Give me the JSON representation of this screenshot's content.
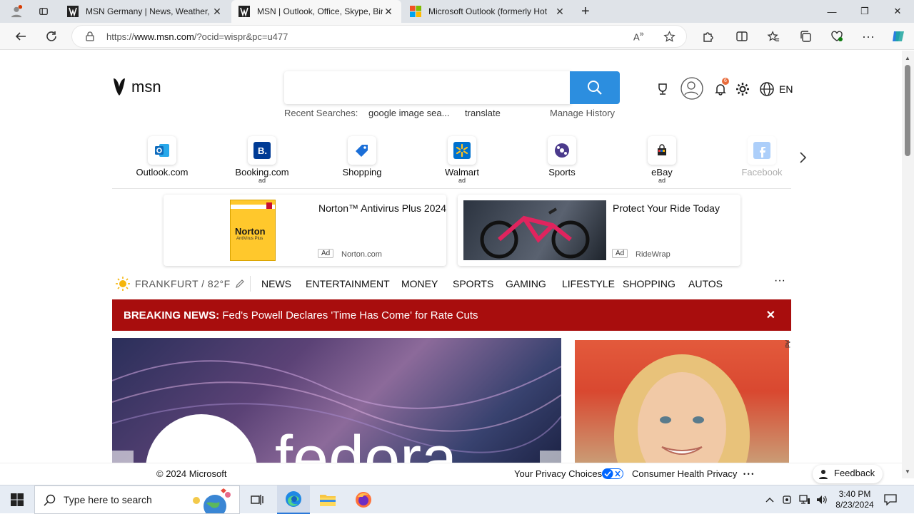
{
  "tabs": [
    {
      "title": "MSN Germany | News, Weather,",
      "close": "✕"
    },
    {
      "title": "MSN | Outlook, Office, Skype, Bir",
      "close": "✕"
    },
    {
      "title": "Microsoft Outlook (formerly Hot",
      "close": "✕"
    }
  ],
  "new_tab": "+",
  "window": {
    "minimize": "—",
    "restore": "❐",
    "close": "✕"
  },
  "address": {
    "prefix": "https://",
    "domain": "www.msn.com",
    "rest": "/?ocid=wispr&pc=u477"
  },
  "header": {
    "logo_text": "msn",
    "search_value": "",
    "recent_label": "Recent Searches:",
    "recent_items": [
      "google image sea...",
      "translate"
    ],
    "manage_history": "Manage History",
    "notification_count": "6",
    "language": "EN"
  },
  "quick_links": [
    {
      "label": "Outlook.com",
      "ad": ""
    },
    {
      "label": "Booking.com",
      "ad": "ad"
    },
    {
      "label": "Shopping",
      "ad": ""
    },
    {
      "label": "Walmart",
      "ad": "ad"
    },
    {
      "label": "Sports",
      "ad": ""
    },
    {
      "label": "eBay",
      "ad": "ad"
    },
    {
      "label": "Facebook",
      "ad": ""
    }
  ],
  "ads": [
    {
      "headline": "Norton™ Antivirus Plus 2024",
      "badge": "Ad",
      "source": "Norton.com",
      "product_brand": "Norton",
      "product_sub": "AntiVirus Plus"
    },
    {
      "headline": "Protect Your Ride Today",
      "badge": "Ad",
      "source": "RideWrap"
    }
  ],
  "weather": {
    "location": "FRANKFURT / 82°F"
  },
  "nav": [
    "NEWS",
    "ENTERTAINMENT",
    "MONEY",
    "SPORTS",
    "GAMING",
    "LIFESTYLE",
    "SHOPPING",
    "AUTOS"
  ],
  "nav_more": "···",
  "breaking": {
    "label": "BREAKING NEWS:",
    "text": "Fed's Powell Declares 'Time Has Come' for Rate Cuts",
    "close": "✕"
  },
  "hero_ad_tag": "Ad",
  "footer": {
    "copyright": "© 2024 Microsoft",
    "privacy": "Your Privacy Choices",
    "health": "Consumer Health Privacy",
    "more": "• • •",
    "feedback": "Feedback"
  },
  "taskbar": {
    "search_placeholder": "Type here to search",
    "time": "3:40 PM",
    "date": "8/23/2024"
  },
  "colors": {
    "accent": "#2c8edf",
    "breaking": "#a80d0d"
  }
}
